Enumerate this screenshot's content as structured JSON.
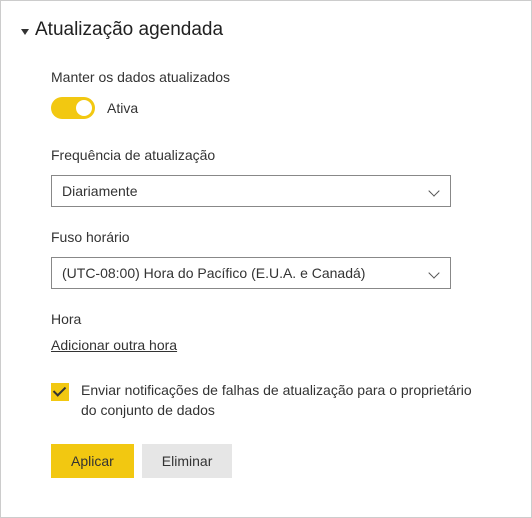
{
  "section": {
    "title": "Atualização agendada"
  },
  "keepUpdated": {
    "label": "Manter os dados atualizados",
    "statusLabel": "Ativa"
  },
  "frequency": {
    "label": "Frequência de atualização",
    "value": "Diariamente"
  },
  "timezone": {
    "label": "Fuso horário",
    "value": "(UTC-08:00) Hora do Pacífico (E.U.A. e Canadá)"
  },
  "time": {
    "label": "Hora",
    "addLink": "Adicionar outra hora"
  },
  "notify": {
    "label": "Enviar notificações de falhas de atualização para o proprietário do conjunto de dados"
  },
  "buttons": {
    "apply": "Aplicar",
    "delete": "Eliminar"
  }
}
